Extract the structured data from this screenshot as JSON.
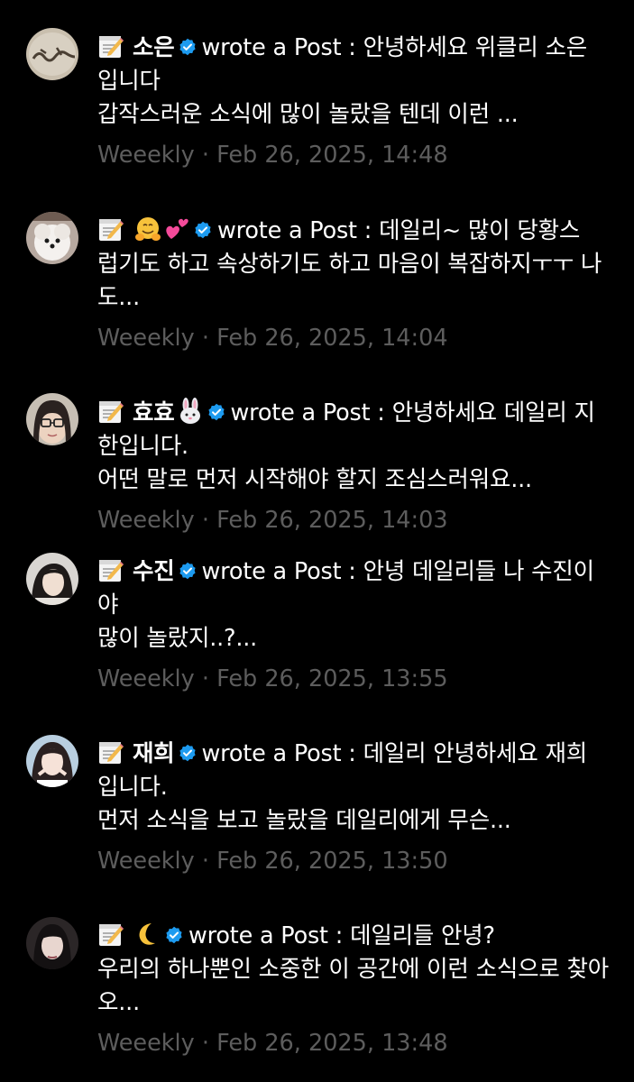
{
  "accent_color": "#1d9bf0",
  "meta_color": "#5d5d5d",
  "notifications": [
    {
      "author": "소은",
      "author_emoji": [],
      "action": "wrote a Post :",
      "lines": [
        "안녕하세요 위클리 소은",
        "입니다",
        "갑작스러운 소식에 많이 놀랐을 텐데 이런 ..."
      ],
      "group": "Weeekly",
      "separator": "·",
      "timestamp": "Feb 26, 2025, 14:48",
      "icon": "memo-icon"
    },
    {
      "author": "",
      "author_emoji": [
        "hugging-face-emoji",
        "two-hearts-emoji"
      ],
      "action": "wrote a Post :",
      "lines": [
        "데일리~ 많이 당황스",
        "럽기도 하고 속상하기도 하고 마음이 복잡하지ㅜㅜ 나",
        "도..."
      ],
      "group": "Weeekly",
      "separator": "·",
      "timestamp": "Feb 26, 2025, 14:04",
      "icon": "memo-icon"
    },
    {
      "author": "효효",
      "author_emoji": [
        "rabbit-face-emoji"
      ],
      "action": "wrote a Post :",
      "lines": [
        "안녕하세요 데일리 지",
        "한입니다.",
        "어떤 말로 먼저 시작해야 할지 조심스러워요..."
      ],
      "group": "Weeekly",
      "separator": "·",
      "timestamp": "Feb 26, 2025, 14:03",
      "icon": "memo-icon"
    },
    {
      "author": "수진",
      "author_emoji": [],
      "action": "wrote a Post :",
      "lines": [
        "안녕 데일리들 나 수진이",
        "야",
        "많이 놀랐지..?..."
      ],
      "group": "Weeekly",
      "separator": "·",
      "timestamp": "Feb 26, 2025, 13:55",
      "icon": "memo-icon"
    },
    {
      "author": "재희",
      "author_emoji": [],
      "action": "wrote a Post :",
      "lines": [
        "데일리 안녕하세요 재희",
        "입니다.",
        "먼저 소식을 보고 놀랐을 데일리에게 무슨..."
      ],
      "group": "Weeekly",
      "separator": "·",
      "timestamp": "Feb 26, 2025, 13:50",
      "icon": "memo-icon"
    },
    {
      "author": "",
      "author_emoji": [
        "crescent-moon-emoji"
      ],
      "action": "wrote a Post :",
      "lines": [
        "데일리들 안녕?",
        "우리의 하나뿐인 소중한 이 공간에 이런 소식으로 찾아",
        "오..."
      ],
      "group": "Weeekly",
      "separator": "·",
      "timestamp": "Feb 26, 2025, 13:48",
      "icon": "memo-icon"
    }
  ]
}
